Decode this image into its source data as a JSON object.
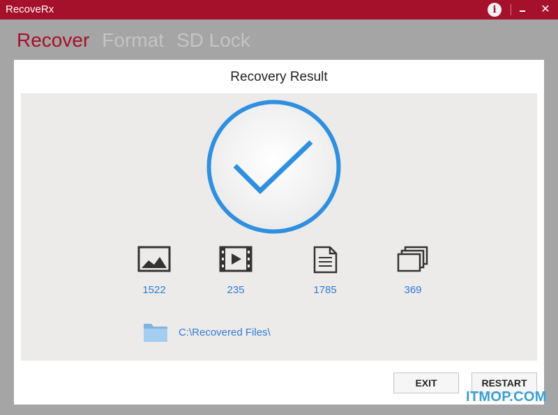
{
  "window": {
    "title": "RecoveRx"
  },
  "nav": {
    "tabs": [
      {
        "label": "Recover"
      },
      {
        "label": "Format"
      },
      {
        "label": "SD Lock"
      }
    ]
  },
  "result": {
    "heading": "Recovery Result",
    "stats": [
      {
        "icon": "photo-icon",
        "count": "1522"
      },
      {
        "icon": "video-icon",
        "count": "235"
      },
      {
        "icon": "document-icon",
        "count": "1785"
      },
      {
        "icon": "other-files-icon",
        "count": "369"
      }
    ],
    "folder_path": "C:\\Recovered Files\\"
  },
  "buttons": {
    "exit": "EXIT",
    "restart": "RESTART"
  },
  "watermark": "ITMOP.COM",
  "colors": {
    "titlebar": "#a5102a",
    "accent_blue": "#2f7bd6",
    "check_blue": "#2f8fe0",
    "inactive_tab": "#c4c4c4"
  }
}
